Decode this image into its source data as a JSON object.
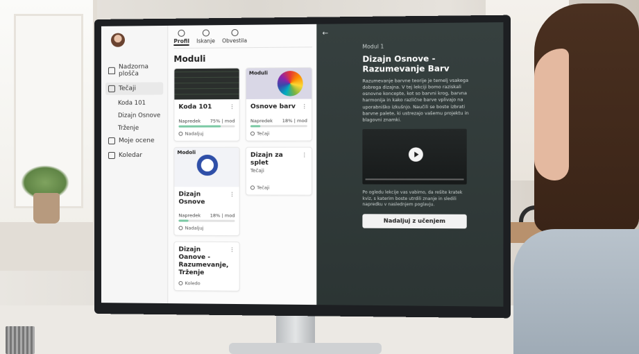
{
  "sidebar": {
    "items": [
      {
        "label": "Nadzorna plošča",
        "icon": "home-icon"
      },
      {
        "label": "Tečaji",
        "icon": "courses-icon",
        "active": true
      },
      {
        "label": "Moje ocene",
        "icon": "grades-icon"
      },
      {
        "label": "Koledar",
        "icon": "calendar-icon"
      }
    ],
    "sub_items": [
      "Koda 101",
      "Dizajn Osnove",
      "Trženje"
    ]
  },
  "tabs": [
    {
      "label": "Profil",
      "icon": "user-icon"
    },
    {
      "label": "Iskanje",
      "icon": "search-icon"
    },
    {
      "label": "Obvestila",
      "icon": "bell-icon"
    }
  ],
  "main": {
    "title": "Moduli",
    "cards": [
      {
        "title": "Koda 101",
        "progress_label": "Napredek",
        "progress_text": "75% | mod",
        "progress": 0.75,
        "footer": "Nadaljuj",
        "thumb": "code"
      },
      {
        "title": "Osnove barv",
        "thumb_label": "Moduli",
        "progress_label": "Napredek",
        "progress_text": "18% | mod",
        "progress": 0.18,
        "footer": "Tečaji",
        "thumb": "color-wheel"
      },
      {
        "title": "Dizajn Osnove",
        "thumb_label": "Modoli",
        "progress_label": "Napredek",
        "progress_text": "18% | mod",
        "progress": 0.18,
        "footer": "Nadaljuj",
        "thumb": "ring"
      },
      {
        "title": "Dizajn za splet",
        "subtitle": "Tečaji",
        "footer": "Tečaji"
      },
      {
        "title": "Dizajn Oanove - Razumevanje, Trženje",
        "footer": "Koledo"
      }
    ]
  },
  "panel": {
    "back_icon": "←",
    "kicker": "Modul 1",
    "title": "Dizajn Osnove - Razumevanje Barv",
    "body": "Razumevanje barvne teorije je temelj vsakega dobrega dizajna. V tej lekciji bomo raziskali osnovne koncepte, kot so barvni krog, barvna harmonija in kako različne barve vplivajo na uporabniško izkušnjo. Naučili se boste izbrati barvne palete, ki ustrezajo vašemu projektu in blagovni znamki.",
    "note": "Po ogledu lekcije vas vabimo, da rešite kratek kviz, s katerim boste utrdili znanje in sledili napredku v naslednjem poglavju.",
    "cta": "Nadaljuj z učenjem"
  }
}
